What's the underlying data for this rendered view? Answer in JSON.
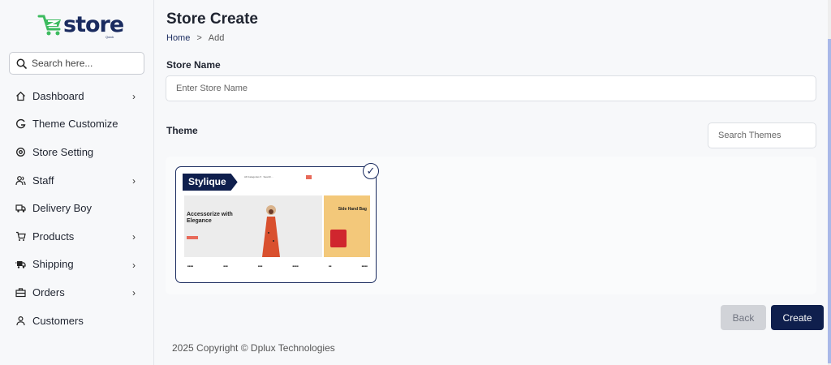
{
  "app": {
    "logo_text": "store",
    "logo_sub": "Quick"
  },
  "sidebar": {
    "search_placeholder": "Search here...",
    "items": [
      {
        "label": "Dashboard",
        "icon": "home-icon",
        "has_children": true
      },
      {
        "label": "Theme Customize",
        "icon": "customize-icon",
        "has_children": false
      },
      {
        "label": "Store Setting",
        "icon": "gear-icon",
        "has_children": false
      },
      {
        "label": "Staff",
        "icon": "users-icon",
        "has_children": true
      },
      {
        "label": "Delivery Boy",
        "icon": "truck-icon",
        "has_children": false
      },
      {
        "label": "Products",
        "icon": "cart-icon",
        "has_children": true
      },
      {
        "label": "Shipping",
        "icon": "shipping-icon",
        "has_children": true
      },
      {
        "label": "Orders",
        "icon": "briefcase-icon",
        "has_children": true
      },
      {
        "label": "Customers",
        "icon": "user-icon",
        "has_children": false
      }
    ]
  },
  "header": {
    "title": "Store Create",
    "breadcrumb": {
      "home": "Home",
      "separator": ">",
      "current": "Add"
    }
  },
  "form": {
    "store_name_label": "Store Name",
    "store_name_placeholder": "Enter Store Name",
    "store_name_value": "",
    "theme_label": "Theme",
    "theme_search_placeholder": "Search Themes"
  },
  "themes": [
    {
      "name": "Stylique",
      "selected": true,
      "preview": {
        "hero_title": "Accessorize with Elegance",
        "side_title": "Side Hand Bag"
      }
    }
  ],
  "actions": {
    "back_label": "Back",
    "create_label": "Create"
  },
  "footer": {
    "text": "2025 Copyright © Dplux Technologies"
  },
  "colors": {
    "primary": "#0f1f4d",
    "accent_green": "#3dbb5f",
    "back_button": "#d1d3d8"
  }
}
